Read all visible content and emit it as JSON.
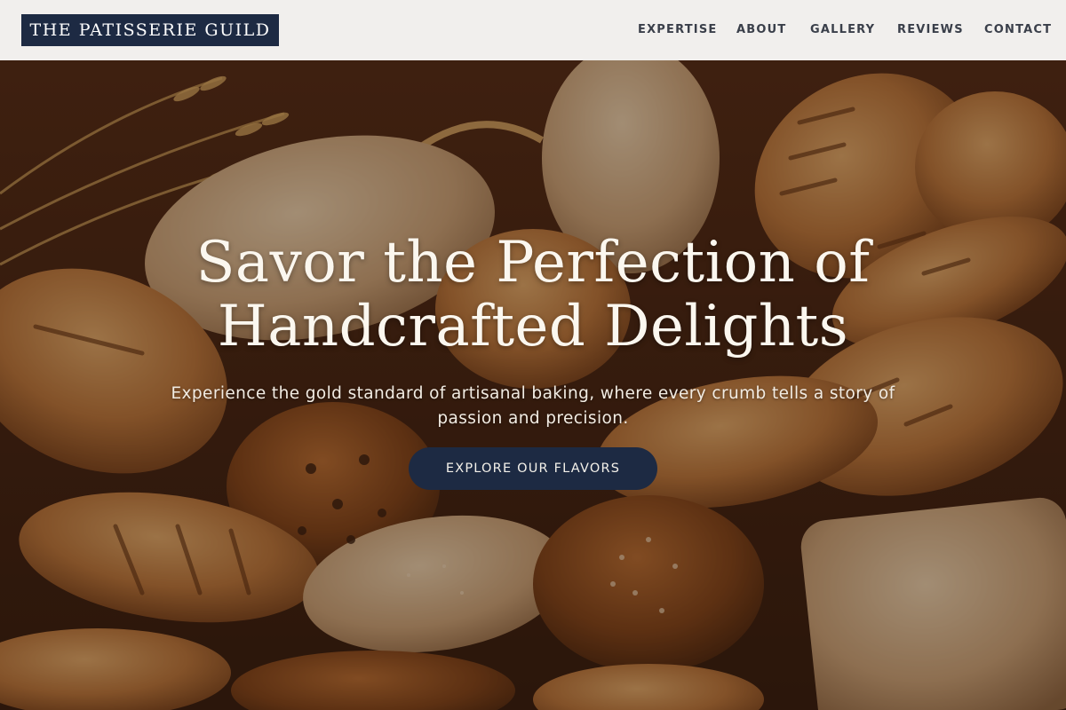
{
  "header": {
    "logo_text": "THE PATISSERIE GUILD",
    "nav": [
      {
        "label": "EXPERTISE"
      },
      {
        "label": "ABOUT"
      },
      {
        "label": "GALLERY"
      },
      {
        "label": "REVIEWS"
      },
      {
        "label": "CONTACT"
      }
    ]
  },
  "hero": {
    "title_line1": "Savor the Perfection of",
    "title_line2": "Handcrafted Delights",
    "subtitle_line1": "Experience the gold standard of artisanal baking, where every crumb tells a story of",
    "subtitle_line2": "passion and precision.",
    "cta_label": "EXPLORE OUR FLAVORS",
    "background_image": "bread-basket-image"
  },
  "colors": {
    "brand_navy": "#1d2a43",
    "header_bg": "#f1efed",
    "nav_text": "#3a3f4a",
    "hero_text": "#fbf7ef"
  }
}
